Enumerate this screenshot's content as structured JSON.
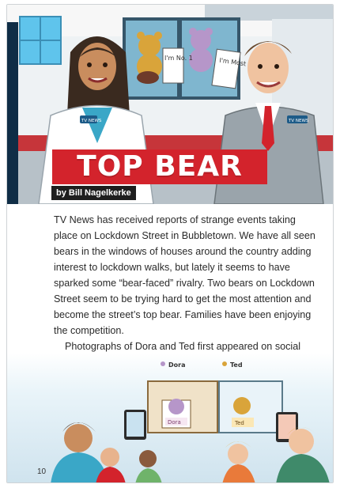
{
  "article": {
    "title": "TOP BEAR",
    "byline": "by Bill Nagelkerke",
    "paragraph1": "TV News has received reports of strange events taking place on Lockdown Street in Bubbletown. We have all seen bears in the windows of houses around the country adding interest to lockdown walks, but lately it seems to have sparked some “bear-faced” rivalry. Two bears on Lockdown Street seem to be trying hard to get the most attention and become the street’s top bear. Families have been enjoying the competition.",
    "paragraph2": "Photographs of Dora and Ted first appeared on social media in March.",
    "page_number": "10"
  },
  "illustration_text": {
    "badge_left": "TV NEWS",
    "badge_right": "TV NEWS",
    "sign_left": "I'm No. 1",
    "sign_right": "I'm Most",
    "tag_dora": "Dora",
    "tag_ted": "Ted",
    "plaque_dora": "Dora",
    "plaque_ted": "Ted"
  },
  "colors": {
    "title_red": "#d3232c",
    "byline_black": "#1e1e1e",
    "navy_edge": "#0f2d46"
  }
}
